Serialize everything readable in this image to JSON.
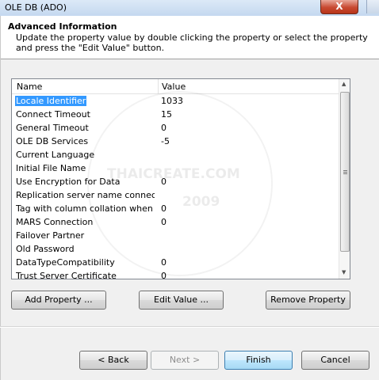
{
  "window": {
    "title": "OLE DB (ADO)",
    "close_glyph": "X"
  },
  "header": {
    "title": "Advanced Information",
    "description": "Update the property value by double clicking the property or select the property and press the \"Edit Value\" button."
  },
  "list": {
    "columns": {
      "name": "Name",
      "value": "Value"
    },
    "rows": [
      {
        "name": "Locale Identifier",
        "value": "1033"
      },
      {
        "name": "Connect Timeout",
        "value": "15"
      },
      {
        "name": "General Timeout",
        "value": "0"
      },
      {
        "name": "OLE DB Services",
        "value": "-5"
      },
      {
        "name": "Current Language",
        "value": ""
      },
      {
        "name": "Initial File Name",
        "value": ""
      },
      {
        "name": "Use Encryption for Data",
        "value": "0"
      },
      {
        "name": "Replication server name connect o...",
        "value": ""
      },
      {
        "name": "Tag with column collation when p...",
        "value": "0"
      },
      {
        "name": "MARS Connection",
        "value": "0"
      },
      {
        "name": "Failover Partner",
        "value": ""
      },
      {
        "name": "Old Password",
        "value": ""
      },
      {
        "name": "DataTypeCompatibility",
        "value": "0"
      },
      {
        "name": "Trust Server Certificate",
        "value": "0"
      }
    ]
  },
  "watermark": {
    "line1": "THAICREATE.COM",
    "line2": "2009"
  },
  "buttons": {
    "add_property": "Add Property ...",
    "edit_value": "Edit Value ...",
    "remove_property": "Remove Property",
    "back": "< Back",
    "next": "Next >",
    "finish": "Finish",
    "cancel": "Cancel"
  },
  "colors": {
    "selection": "#3399ff",
    "title_bar": "#c4d8ef",
    "close_button": "#c84a32"
  }
}
